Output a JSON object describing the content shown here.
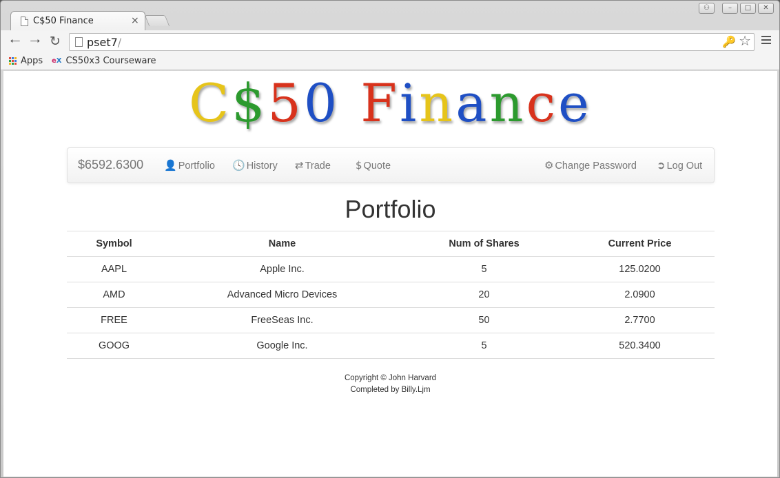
{
  "browser": {
    "tab_title": "C$50 Finance",
    "tab_close": "×",
    "url_host": "pset7",
    "url_path": "/",
    "bookmarks": [
      {
        "label": "Apps",
        "icon": "apps-grid-icon"
      },
      {
        "label": "CS50x3 Courseware",
        "icon": "edx-icon"
      }
    ],
    "edx_icon_text": [
      "e",
      "X"
    ]
  },
  "logo": {
    "letters": [
      {
        "char": "C",
        "color": "#e6c41a"
      },
      {
        "char": "$",
        "color": "#2c9a2e"
      },
      {
        "char": "5",
        "color": "#d8321c"
      },
      {
        "char": "0",
        "color": "#1f4fc4"
      },
      {
        "char": " ",
        "color": "#000000"
      },
      {
        "char": "F",
        "color": "#d8321c"
      },
      {
        "char": "i",
        "color": "#1f4fc4"
      },
      {
        "char": "n",
        "color": "#e6c41a"
      },
      {
        "char": "a",
        "color": "#1f4fc4"
      },
      {
        "char": "n",
        "color": "#2c9a2e"
      },
      {
        "char": "c",
        "color": "#d8321c"
      },
      {
        "char": "e",
        "color": "#1f4fc4"
      }
    ]
  },
  "nav": {
    "cash": "$6592.6300",
    "portfolio": {
      "label": "Portfolio",
      "icon": "user-icon"
    },
    "history": {
      "label": "History",
      "icon": "clock-icon"
    },
    "trade": {
      "label": "Trade",
      "icon": "shuffle-icon"
    },
    "quote": {
      "label": "Quote",
      "icon": "dollar-icon"
    },
    "change_password": {
      "label": "Change Password",
      "icon": "gear-icon"
    },
    "logout": {
      "label": "Log Out",
      "icon": "log-out-icon"
    }
  },
  "page_title": "Portfolio",
  "table": {
    "headers": [
      "Symbol",
      "Name",
      "Num of Shares",
      "Current Price"
    ],
    "rows": [
      [
        "AAPL",
        "Apple Inc.",
        "5",
        "125.0200"
      ],
      [
        "AMD",
        "Advanced Micro Devices",
        "20",
        "2.0900"
      ],
      [
        "FREE",
        "FreeSeas Inc.",
        "50",
        "2.7700"
      ],
      [
        "GOOG",
        "Google Inc.",
        "5",
        "520.3400"
      ]
    ]
  },
  "footer": {
    "line1": "Copyright © John Harvard",
    "line2": "Completed by Billy.Ljm"
  }
}
